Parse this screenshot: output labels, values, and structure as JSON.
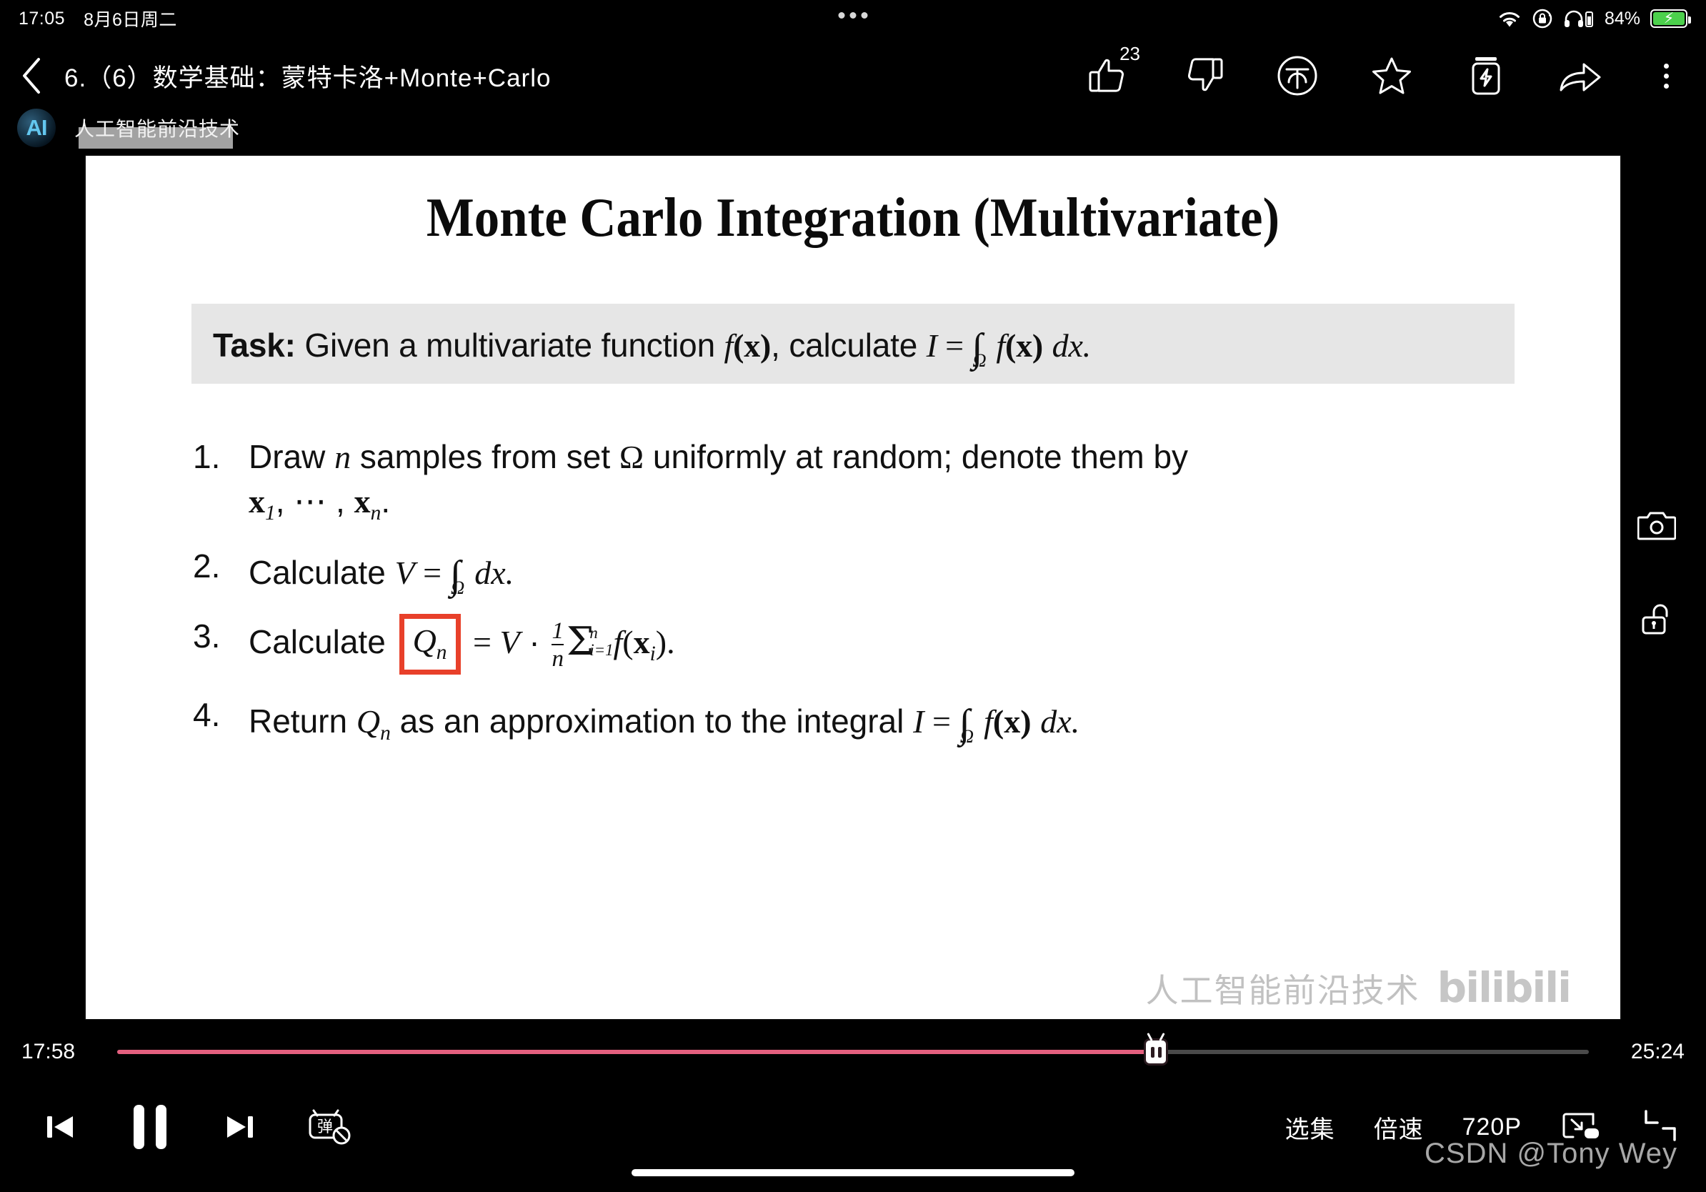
{
  "status_bar": {
    "time": "17:05",
    "date": "8月6日周二",
    "battery_percent": "84%",
    "icons": [
      "wifi-icon",
      "rotation-lock-icon",
      "headphones-icon",
      "battery-charging-icon"
    ]
  },
  "top_nav": {
    "back_icon": "chevron-left-icon",
    "title": "6.（6）数学基础：蒙特卡洛+Monte+Carlo",
    "actions": [
      {
        "name": "like-button",
        "icon": "thumbs-up-icon",
        "count": "23"
      },
      {
        "name": "dislike-button",
        "icon": "thumbs-down-icon",
        "count": ""
      },
      {
        "name": "coin-button",
        "icon": "coin-icon",
        "count": ""
      },
      {
        "name": "favorite-button",
        "icon": "star-icon",
        "count": ""
      },
      {
        "name": "charge-button",
        "icon": "battery-bolt-icon",
        "count": ""
      },
      {
        "name": "share-button",
        "icon": "share-arrow-icon",
        "count": ""
      },
      {
        "name": "more-button",
        "icon": "kebab-menu-icon",
        "count": ""
      }
    ]
  },
  "watermarks": {
    "channel_logo": "AI",
    "channel_name": "人工智能前沿技术",
    "slide_brand_cn": "人工智能前沿技术",
    "slide_brand_logo": "bilibili",
    "csdn": "CSDN @Tony Wey"
  },
  "slide": {
    "title": "Monte Carlo Integration (Multivariate)",
    "task": {
      "label": "Task:",
      "text_plain": "Given a multivariate function f(x), calculate I = ∫Ω f(x) dx.",
      "prefix": "Given a multivariate function ",
      "fn": "f",
      "arg": "(x)",
      "mid": ", calculate ",
      "I": "I",
      "eq": " = ",
      "integral": "∫",
      "domain": "Ω",
      "tail_fn": "f",
      "tail_arg": "(x)",
      "dx": "dx."
    },
    "steps": [
      {
        "num": "1.",
        "text_plain": "Draw n samples from set Ω uniformly at random; denote them by x1, ⋯ , xn.",
        "part_a": "Draw ",
        "var_n": "n",
        "part_b": " samples from set ",
        "set": "Ω",
        "part_c": " uniformly at random; denote them by",
        "vec1": "x",
        "sub1": "1",
        "dots": ", ⋯ , ",
        "vec2": "x",
        "sub2": "n",
        "period": "."
      },
      {
        "num": "2.",
        "text_plain": "Calculate V = ∫Ω dx.",
        "part_a": "Calculate ",
        "V": "V",
        "eq": " = ",
        "integral": "∫",
        "domain": "Ω",
        "dx": "dx."
      },
      {
        "num": "3.",
        "text_plain": "Calculate Qn = V · (1/n) Σi=1..n f(xi).",
        "part_a": "Calculate ",
        "highlight": "Q",
        "highlight_sub": "n",
        "eq": " = ",
        "V": "V",
        "dot": " · ",
        "frac_num": "1",
        "frac_den": "n",
        "sigma": "Σ",
        "sigma_top": "n",
        "sigma_bottom": "i=1",
        "fn": "f",
        "open": "(",
        "vec": "x",
        "vsub": "i",
        "close": ")."
      },
      {
        "num": "4.",
        "text_plain": "Return Qn as an approximation to the integral I = ∫Ω f(x) dx.",
        "part_a": "Return ",
        "Q": "Q",
        "Qsub": "n",
        "part_b": " as an approximation to the integral ",
        "I": "I",
        "eq": " = ",
        "integral": "∫",
        "domain": "Ω",
        "fn": "f",
        "arg": "(x)",
        "dx": "dx."
      }
    ],
    "highlight_color": "#e8402a"
  },
  "side_buttons": [
    {
      "name": "screenshot-button",
      "icon": "camera-icon"
    },
    {
      "name": "screen-lock-button",
      "icon": "unlock-icon"
    }
  ],
  "player": {
    "current_time": "17:58",
    "total_time": "25:24",
    "progress_percent": 70.6,
    "progress_color": "#e4607f",
    "handle_icon": "bilibili-tv-handle-icon",
    "controls_left": [
      {
        "name": "previous-button",
        "icon": "skip-previous-icon"
      },
      {
        "name": "pause-button",
        "icon": "pause-icon"
      },
      {
        "name": "next-button",
        "icon": "skip-next-icon"
      },
      {
        "name": "danmaku-toggle-button",
        "icon": "danmaku-off-icon"
      }
    ],
    "controls_right": [
      {
        "name": "episode-list-button",
        "label": "选集"
      },
      {
        "name": "playback-speed-button",
        "label": "倍速"
      },
      {
        "name": "quality-button",
        "label": "720P"
      },
      {
        "name": "picture-in-picture-button",
        "label": ""
      },
      {
        "name": "aspect-ratio-button",
        "label": ""
      }
    ]
  }
}
